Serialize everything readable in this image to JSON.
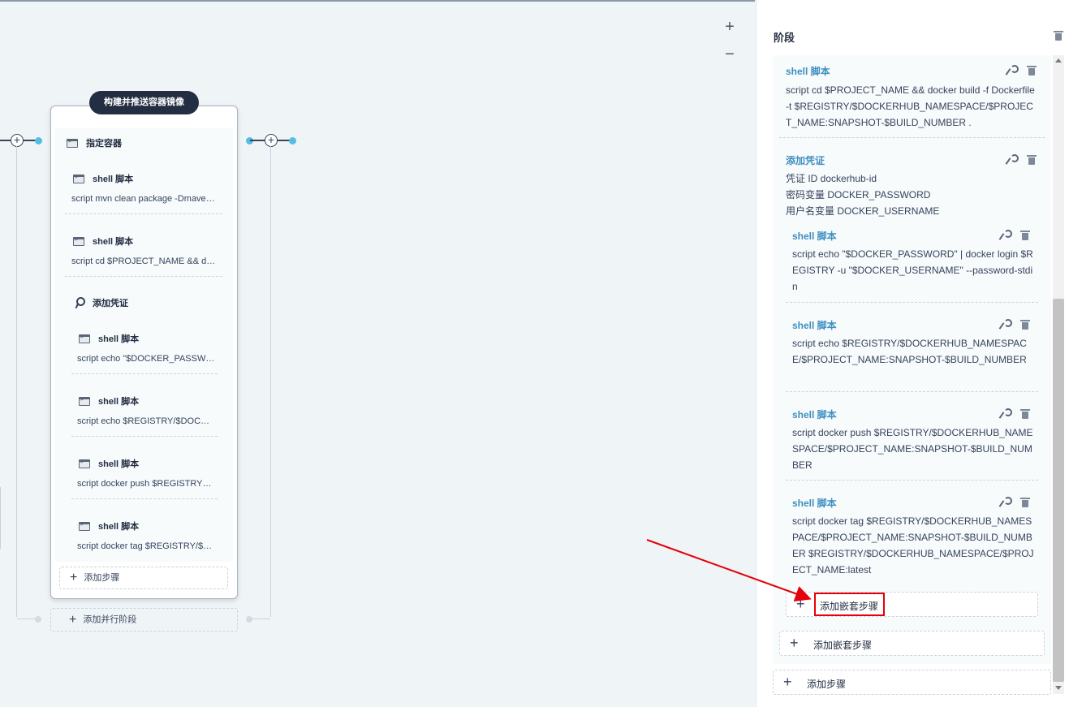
{
  "canvas": {
    "zoom_in": "+",
    "zoom_out": "−",
    "connector_plus": "+",
    "stage": {
      "name": "构建并推送容器镜像",
      "container_label": "指定容器",
      "steps": [
        {
          "title": "shell 脚本",
          "script": "script   mvn clean package -Dmaven.test.skip=true"
        },
        {
          "title": "shell 脚本",
          "script": "script   cd $PROJECT_NAME && docker build"
        },
        {
          "title": "添加凭证",
          "script": ""
        },
        {
          "title": "shell 脚本",
          "script": "script   echo \"$DOCKER_PASSWORD\" | docker login"
        },
        {
          "title": "shell 脚本",
          "script": "script   echo $REGISTRY/$DOCKERHUB_NAMESPACE"
        },
        {
          "title": "shell 脚本",
          "script": "script   docker push $REGISTRY/$DOCKERHUB"
        },
        {
          "title": "shell 脚本",
          "script": "script   docker tag $REGISTRY/$DOCKERHUB"
        }
      ],
      "add_step": "添加步骤",
      "add_parallel": "添加并行阶段"
    }
  },
  "panel": {
    "title": "阶段",
    "shell_top": {
      "title": "shell 脚本",
      "text": "script   cd $PROJECT_NAME && docker build -f Dockerfile -t $REGISTRY/$DOCKERHUB_NAMESPACE/$PROJECT_NAME:SNAPSHOT-$BUILD_NUMBER ."
    },
    "credential": {
      "title": "添加凭证",
      "lines": [
        "凭证 ID   dockerhub-id",
        "密码变量   DOCKER_PASSWORD",
        "用户名变量   DOCKER_USERNAME"
      ]
    },
    "nested": [
      {
        "title": "shell 脚本",
        "text": "script   echo \"$DOCKER_PASSWORD\" | docker login $REGISTRY -u \"$DOCKER_USERNAME\" --password-stdin"
      },
      {
        "title": "shell 脚本",
        "text": "script   echo $REGISTRY/$DOCKERHUB_NAMESPACE/$PROJECT_NAME:SNAPSHOT-$BUILD_NUMBER"
      },
      {
        "title": "shell 脚本",
        "text": "script   docker push $REGISTRY/$DOCKERHUB_NAMESPACE/$PROJECT_NAME:SNAPSHOT-$BUILD_NUMBER"
      },
      {
        "title": "shell 脚本",
        "text": "script   docker tag $REGISTRY/$DOCKERHUB_NAMESPACE/$PROJECT_NAME:SNAPSHOT-$BUILD_NUMBER $REGISTRY/$DOCKERHUB_NAMESPACE/$PROJECT_NAME:latest"
      }
    ],
    "add_nested_inner": "添加嵌套步骤",
    "add_nested_outer": "添加嵌套步骤",
    "add_step": "添加步骤",
    "plus": "+"
  },
  "colors": {
    "accent": "#3d8fc0",
    "dark": "#242e42",
    "highlight": "#e6000a",
    "arrow": "#e6000a"
  }
}
